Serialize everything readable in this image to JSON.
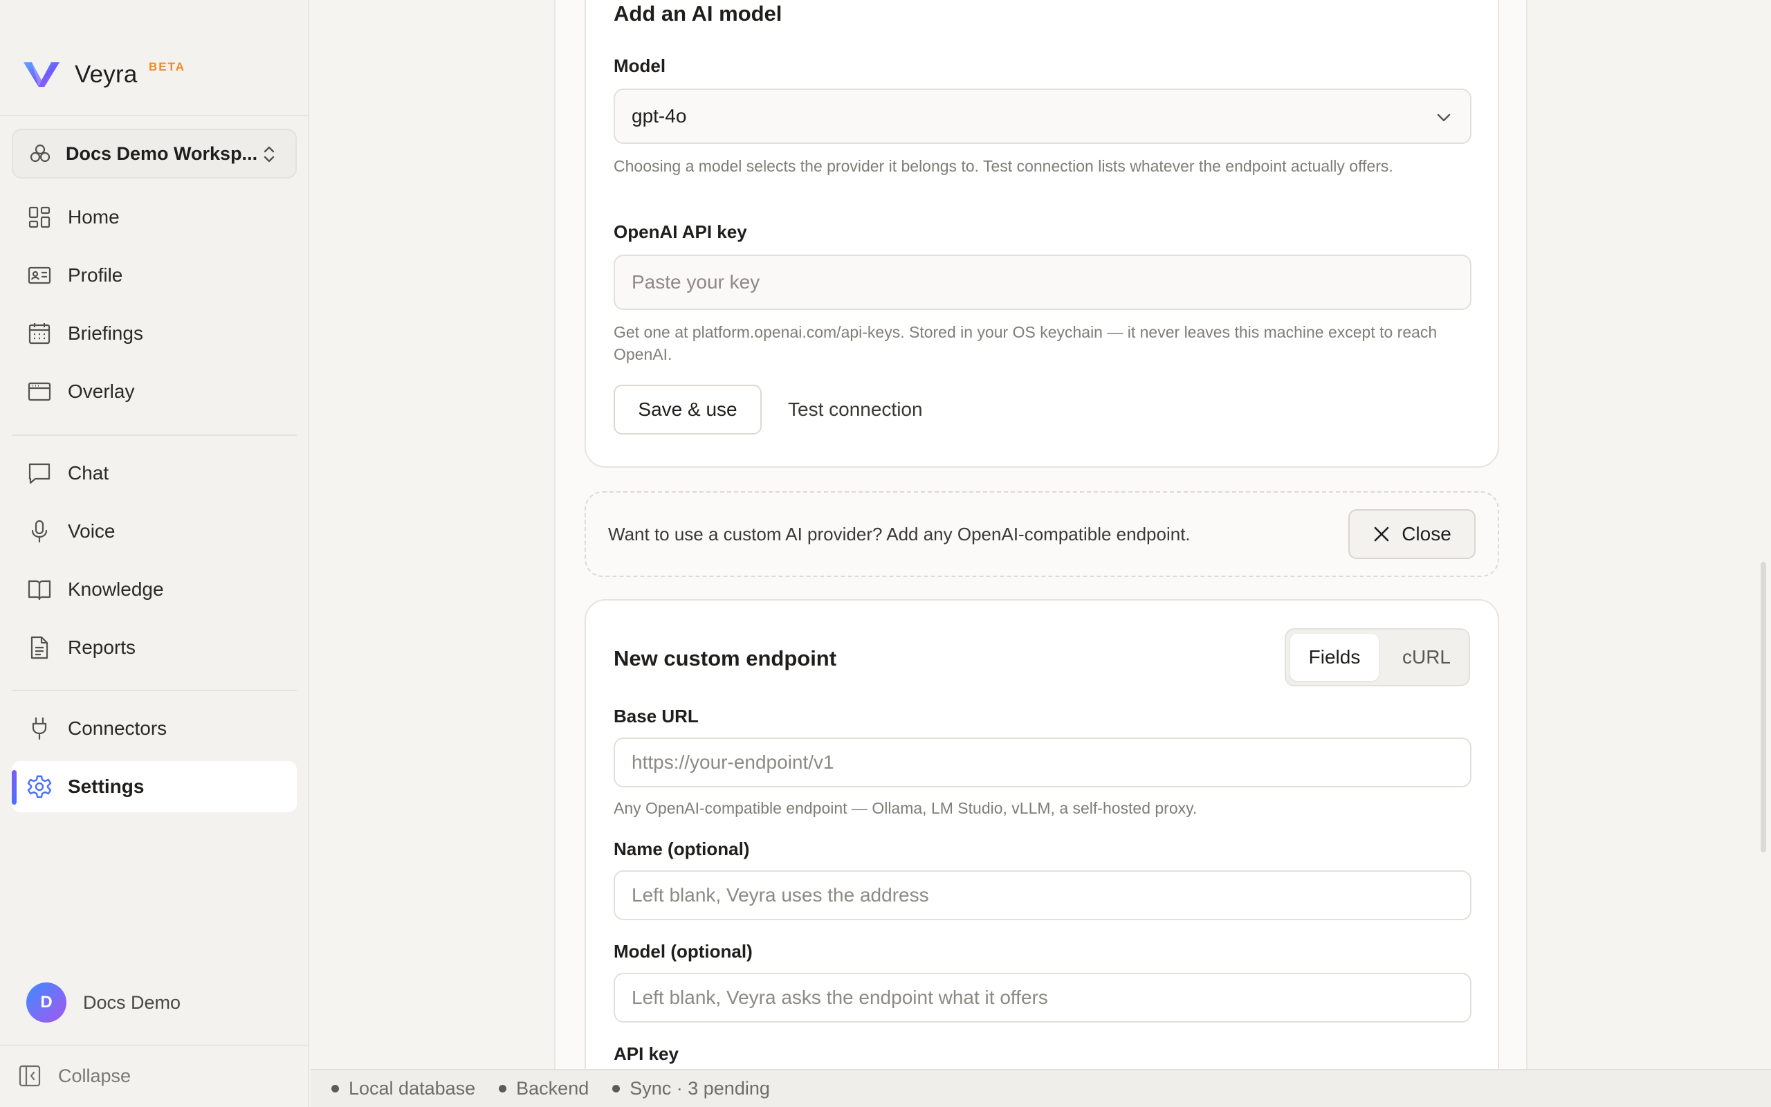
{
  "app": {
    "name": "Veyra",
    "badge": "BETA"
  },
  "workspace": {
    "label": "Docs Demo Worksp..."
  },
  "nav": {
    "home": "Home",
    "profile": "Profile",
    "briefings": "Briefings",
    "overlay": "Overlay",
    "chat": "Chat",
    "voice": "Voice",
    "knowledge": "Knowledge",
    "reports": "Reports",
    "connectors": "Connectors",
    "settings": "Settings",
    "active": "settings"
  },
  "user": {
    "initial": "D",
    "name": "Docs Demo"
  },
  "collapse_label": "Collapse",
  "add_model": {
    "title": "Add an AI model",
    "model_label": "Model",
    "model_value": "gpt-4o",
    "model_help": "Choosing a model selects the provider it belongs to. Test connection lists whatever the endpoint actually offers.",
    "key_label": "OpenAI API key",
    "key_placeholder": "Paste your key",
    "key_help": "Get one at platform.openai.com/api-keys. Stored in your OS keychain — it never leaves this machine except to reach OpenAI.",
    "save_label": "Save & use",
    "test_label": "Test connection"
  },
  "custom_prompt": {
    "text": "Want to use a custom AI provider? Add any OpenAI-compatible endpoint.",
    "close_label": "Close"
  },
  "custom_endpoint": {
    "title": "New custom endpoint",
    "tabs": [
      "Fields",
      "cURL"
    ],
    "active_tab": "Fields",
    "base_url_label": "Base URL",
    "base_url_placeholder": "https://your-endpoint/v1",
    "base_url_help": "Any OpenAI-compatible endpoint — Ollama, LM Studio, vLLM, a self-hosted proxy.",
    "name_label": "Name (optional)",
    "name_placeholder": "Left blank, Veyra uses the address",
    "model_label": "Model (optional)",
    "model_placeholder": "Left blank, Veyra asks the endpoint what it offers",
    "api_key_label": "API key"
  },
  "status": {
    "items": [
      "Local database",
      "Backend",
      "Sync · 3 pending"
    ]
  },
  "colors": {
    "accent": "#4c6fff",
    "beta": "#f08a24"
  }
}
